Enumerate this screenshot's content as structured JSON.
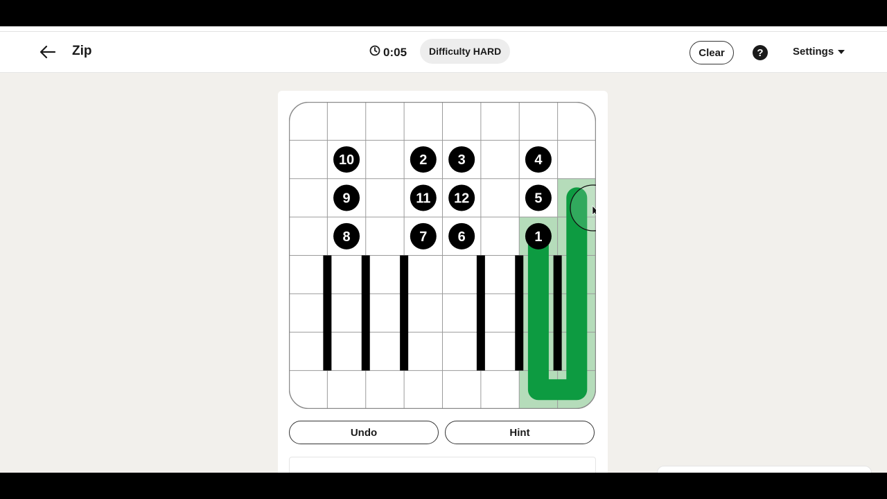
{
  "header": {
    "title": "Zip",
    "timer": "0:05",
    "difficulty": "Difficulty HARD",
    "clear_label": "Clear",
    "help_symbol": "?",
    "settings_label": "Settings"
  },
  "board": {
    "rows": 8,
    "cols": 8,
    "numbers": [
      {
        "label": "10",
        "row": 1,
        "col": 1
      },
      {
        "label": "2",
        "row": 1,
        "col": 3
      },
      {
        "label": "3",
        "row": 1,
        "col": 4
      },
      {
        "label": "4",
        "row": 1,
        "col": 6
      },
      {
        "label": "9",
        "row": 2,
        "col": 1
      },
      {
        "label": "11",
        "row": 2,
        "col": 3
      },
      {
        "label": "12",
        "row": 2,
        "col": 4
      },
      {
        "label": "5",
        "row": 2,
        "col": 6
      },
      {
        "label": "8",
        "row": 3,
        "col": 1
      },
      {
        "label": "7",
        "row": 3,
        "col": 3
      },
      {
        "label": "6",
        "row": 3,
        "col": 4
      },
      {
        "label": "1",
        "row": 3,
        "col": 6
      }
    ],
    "walls": [
      {
        "after_col": 0,
        "row_from": 4,
        "row_to": 6
      },
      {
        "after_col": 1,
        "row_from": 4,
        "row_to": 6
      },
      {
        "after_col": 2,
        "row_from": 4,
        "row_to": 6
      },
      {
        "after_col": 4,
        "row_from": 4,
        "row_to": 6
      },
      {
        "after_col": 5,
        "row_from": 4,
        "row_to": 6
      },
      {
        "after_col": 6,
        "row_from": 4,
        "row_to": 6
      }
    ],
    "path": [
      [
        3,
        6
      ],
      [
        4,
        6
      ],
      [
        5,
        6
      ],
      [
        6,
        6
      ],
      [
        7,
        6
      ],
      [
        7,
        7
      ],
      [
        6,
        7
      ],
      [
        5,
        7
      ],
      [
        4,
        7
      ],
      [
        3,
        7
      ],
      [
        2,
        7
      ]
    ],
    "colors": {
      "path": "#0d9b41",
      "visited": "#b5dcba",
      "grid": "#9a9a9a",
      "number_bg": "#000000",
      "number_fg": "#ffffff"
    }
  },
  "controls": {
    "undo_label": "Undo",
    "hint_label": "Hint"
  }
}
